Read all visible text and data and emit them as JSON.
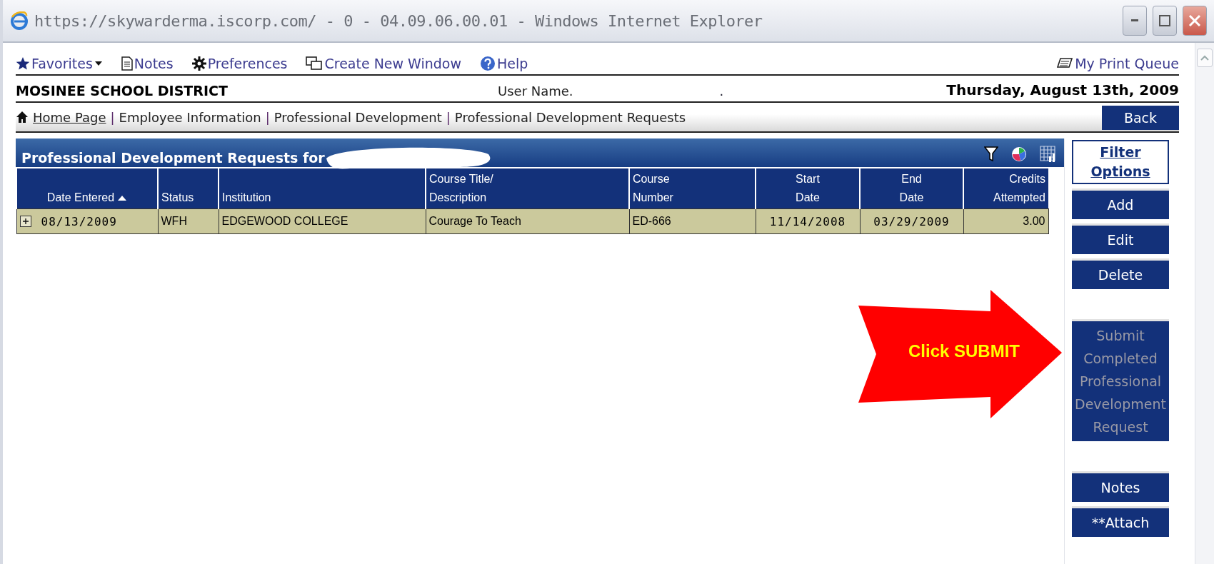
{
  "window": {
    "title": "https://skywarderma.iscorp.com/ - 0 - 04.09.06.00.01 - Windows Internet Explorer"
  },
  "toolbar": {
    "items": [
      {
        "kind": "favorites",
        "label": "Favorites"
      },
      {
        "kind": "notes",
        "label": "Notes"
      },
      {
        "kind": "preferences",
        "label": "Preferences"
      },
      {
        "kind": "window",
        "label": "Create New Window"
      },
      {
        "kind": "help",
        "label": "Help"
      }
    ],
    "print_queue": "My Print Queue"
  },
  "header": {
    "district": "MOSINEE SCHOOL DISTRICT",
    "user_label": "User Name.",
    "user_value": ".",
    "date": "Thursday, August 13th, 2009"
  },
  "breadcrumb": {
    "items": [
      {
        "label": "Home Page",
        "link": true
      },
      {
        "separator": "|",
        "label": "Employee Information",
        "link": false
      },
      {
        "separator": "|",
        "label": "Professional Development",
        "link": false
      },
      {
        "separator": "|",
        "label": "Professional Development Requests",
        "link": false
      }
    ],
    "back": "Back"
  },
  "grid": {
    "title": "Professional Development Requests for",
    "columns": [
      {
        "label": "Date Entered",
        "kind": "date",
        "sorted": true
      },
      {
        "label": "Status",
        "kind": "text",
        "sorted": false
      },
      {
        "label": "Institution",
        "kind": "text",
        "sorted": false
      },
      {
        "label": "Course Title/\nDescription",
        "kind": "text",
        "sorted": false
      },
      {
        "label": "Course\nNumber",
        "kind": "text",
        "sorted": false
      },
      {
        "label": "Start\nDate",
        "kind": "date",
        "sorted": false
      },
      {
        "label": "End\nDate",
        "kind": "date",
        "sorted": false
      },
      {
        "label": "Credits\nAttempted",
        "kind": "number",
        "sorted": false
      }
    ],
    "rows": [
      {
        "expanded": false,
        "cells": [
          "08/13/2009",
          "WFH",
          "EDGEWOOD COLLEGE",
          "Courage To Teach",
          "ED-666",
          "11/14/2008",
          "03/29/2009",
          "3.00"
        ]
      }
    ]
  },
  "action_groups": [
    [
      {
        "kind": "link",
        "label": "Filter Options",
        "disabled": false
      },
      {
        "kind": "button",
        "label": "Add",
        "disabled": false
      },
      {
        "kind": "button",
        "label": "Edit",
        "disabled": false
      },
      {
        "kind": "button",
        "label": "Delete",
        "disabled": false
      }
    ],
    [
      {
        "kind": "button",
        "label": "Submit Completed Professional Development Request",
        "disabled": true
      }
    ],
    [
      {
        "kind": "button",
        "label": "Notes",
        "disabled": false
      },
      {
        "kind": "button",
        "label": "**Attach",
        "disabled": false
      }
    ]
  ],
  "callout": {
    "text": "Click SUBMIT"
  }
}
